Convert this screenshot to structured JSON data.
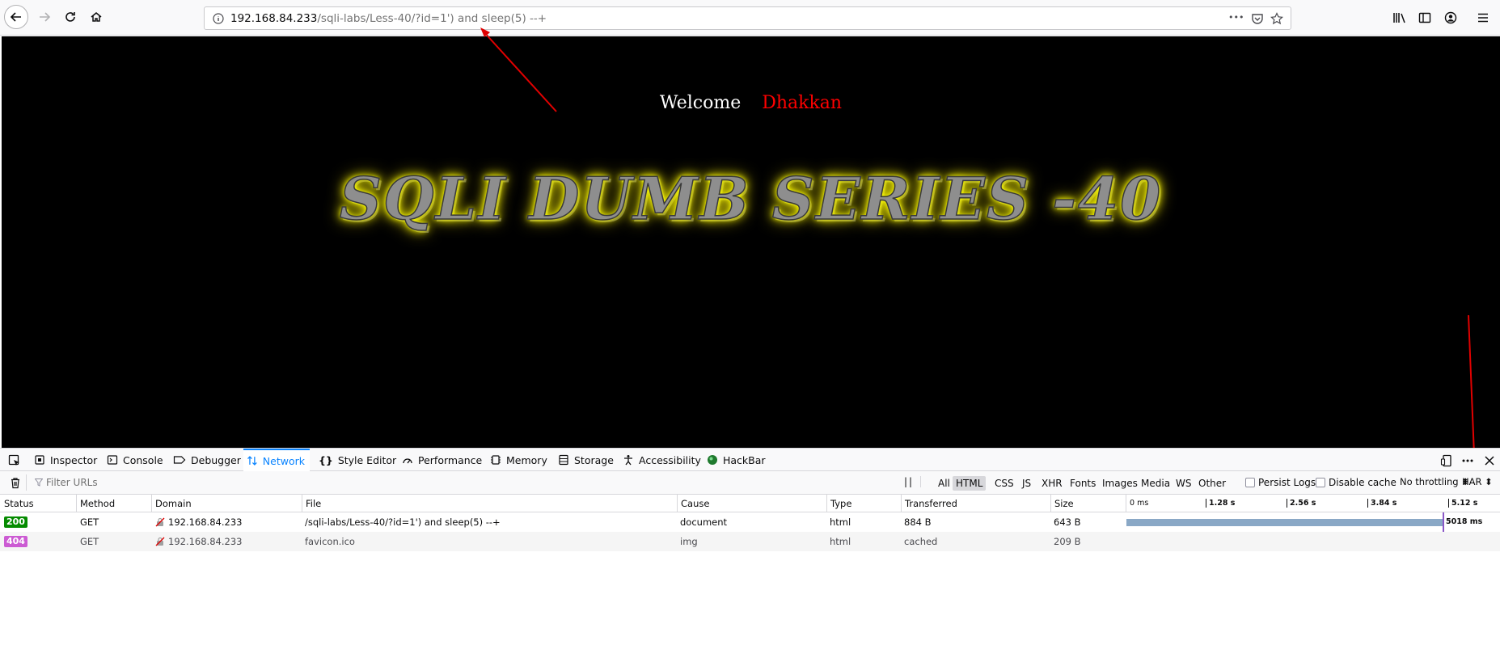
{
  "browser": {
    "url_host": "192.168.84.233",
    "url_path": "/sqli-labs/Less-40/?id=1') and sleep(5) --+",
    "page_actions_glyph": "•••"
  },
  "page": {
    "welcome_text": "Welcome",
    "user_name": "Dhakkan",
    "banner_title": "SQLI DUMB SERIES -40"
  },
  "devtools": {
    "tabs": [
      {
        "label": "Inspector",
        "icon": "inspector-icon"
      },
      {
        "label": "Console",
        "icon": "console-icon"
      },
      {
        "label": "Debugger",
        "icon": "debugger-icon"
      },
      {
        "label": "Network",
        "icon": "network-icon",
        "active": true
      },
      {
        "label": "Style Editor",
        "icon": "style-editor-icon"
      },
      {
        "label": "Performance",
        "icon": "performance-icon"
      },
      {
        "label": "Memory",
        "icon": "memory-icon"
      },
      {
        "label": "Storage",
        "icon": "storage-icon"
      },
      {
        "label": "Accessibility",
        "icon": "accessibility-icon"
      },
      {
        "label": "HackBar",
        "icon": "hackbar-icon"
      }
    ],
    "filter_placeholder": "Filter URLs",
    "filter_types": [
      "All",
      "HTML",
      "CSS",
      "JS",
      "XHR",
      "Fonts",
      "Images",
      "Media",
      "WS",
      "Other"
    ],
    "active_filter": "HTML",
    "persist_logs": "Persist Logs",
    "disable_cache": "Disable cache",
    "throttling": "No throttling ⬍",
    "har": "HAR ⬍",
    "columns": [
      "Status",
      "Method",
      "Domain",
      "File",
      "Cause",
      "Type",
      "Transferred",
      "Size"
    ],
    "timeline_ticks": [
      "0 ms",
      "1.28 s",
      "2.56 s",
      "3.84 s",
      "5.12 s"
    ],
    "requests": [
      {
        "status": "200",
        "status_color": "#058b00",
        "method": "GET",
        "domain": "192.168.84.233",
        "file": "/sqli-labs/Less-40/?id=1') and sleep(5) --+",
        "cause": "document",
        "type": "html",
        "transferred": "884 B",
        "size": "643 B",
        "timing": "5018 ms",
        "duration_ms": 5018
      },
      {
        "status": "404",
        "status_color": "#cc5bd3",
        "method": "GET",
        "domain": "192.168.84.233",
        "file": "favicon.ico",
        "cause": "img",
        "type": "html",
        "transferred": "cached",
        "size": "209 B"
      }
    ]
  },
  "colors": {
    "accent": "#0a84ff",
    "annotation_arrow": "#e00000",
    "waterfall_bar": "#8aa8c6",
    "banner_glow": "#ffff00"
  }
}
